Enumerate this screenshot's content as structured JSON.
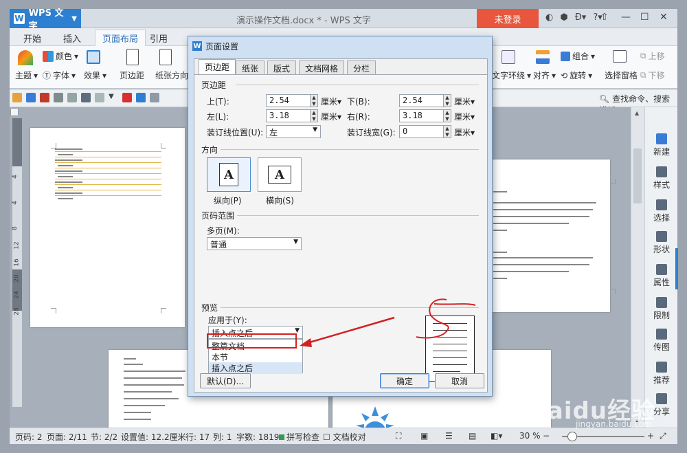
{
  "titlebar": {
    "app_name": "WPS 文字",
    "document_title": "演示操作文档.docx * - WPS 文字",
    "login_label": "未登录",
    "help_label": "?"
  },
  "menu": {
    "tabs": [
      "开始",
      "插入",
      "页面布局",
      "引用"
    ],
    "active_tab": "页面布局"
  },
  "ribbon": {
    "theme": "主题",
    "color": "颜色",
    "font": "字体",
    "effect": "效果",
    "margins": "页边距",
    "orientation": "纸张方向",
    "wrap": "文字环绕",
    "align": "对齐",
    "group": "组合",
    "rotate": "旋转",
    "selection_pane": "选择窗格",
    "bring_forward": "上移",
    "send_backward": "下移"
  },
  "qat": {
    "search_label": "查找命令、搜索模板",
    "doc_tab_char": "演"
  },
  "right_panel": [
    "新建",
    "样式",
    "选择",
    "形状",
    "属性",
    "限制",
    "传图",
    "推荐",
    "分享"
  ],
  "ruler_numbers": [
    "4",
    "4",
    "8",
    "12",
    "16",
    "20",
    "24",
    "28"
  ],
  "dialog": {
    "title": "页面设置",
    "tabs": [
      "页边距",
      "纸张",
      "版式",
      "文档网格",
      "分栏"
    ],
    "margins_section": "页边距",
    "top_label": "上(T):",
    "top_value": "2.54",
    "bottom_label": "下(B):",
    "bottom_value": "2.54",
    "left_label": "左(L):",
    "left_value": "3.18",
    "right_label": "右(R):",
    "right_value": "3.18",
    "gutter_pos_label": "装订线位置(U):",
    "gutter_pos_value": "左",
    "gutter_width_label": "装订线宽(G):",
    "gutter_width_value": "0",
    "unit": "厘米",
    "orientation_section": "方向",
    "portrait_label": "纵向(P)",
    "landscape_label": "横向(S)",
    "page_range_section": "页码范围",
    "multiple_pages_label": "多页(M):",
    "multiple_pages_value": "普通",
    "preview_section": "预览",
    "apply_to_label": "应用于(Y):",
    "apply_to_value": "插入点之后",
    "apply_options": [
      "整篇文档",
      "本节",
      "插入点之后"
    ],
    "default_button": "默认(D)...",
    "ok_button": "确定",
    "cancel_button": "取消"
  },
  "statusbar": {
    "page_num": "页码: 2",
    "page": "页面: 2/11",
    "section": "节: 2/2",
    "setting": "设置值: 12.2厘米",
    "row": "行: 17",
    "col": "列: 1",
    "word_count": "字数: 1819",
    "spell_check": "拼写检查",
    "proofread": "文档校对",
    "zoom": "30 %"
  },
  "watermark": {
    "main": "Baidu经验",
    "sub": "jingyan.baidu.com"
  },
  "colors": {
    "wps_blue": "#2d7fd1",
    "login_red": "#e8563d",
    "annotation_red": "#d32020"
  }
}
